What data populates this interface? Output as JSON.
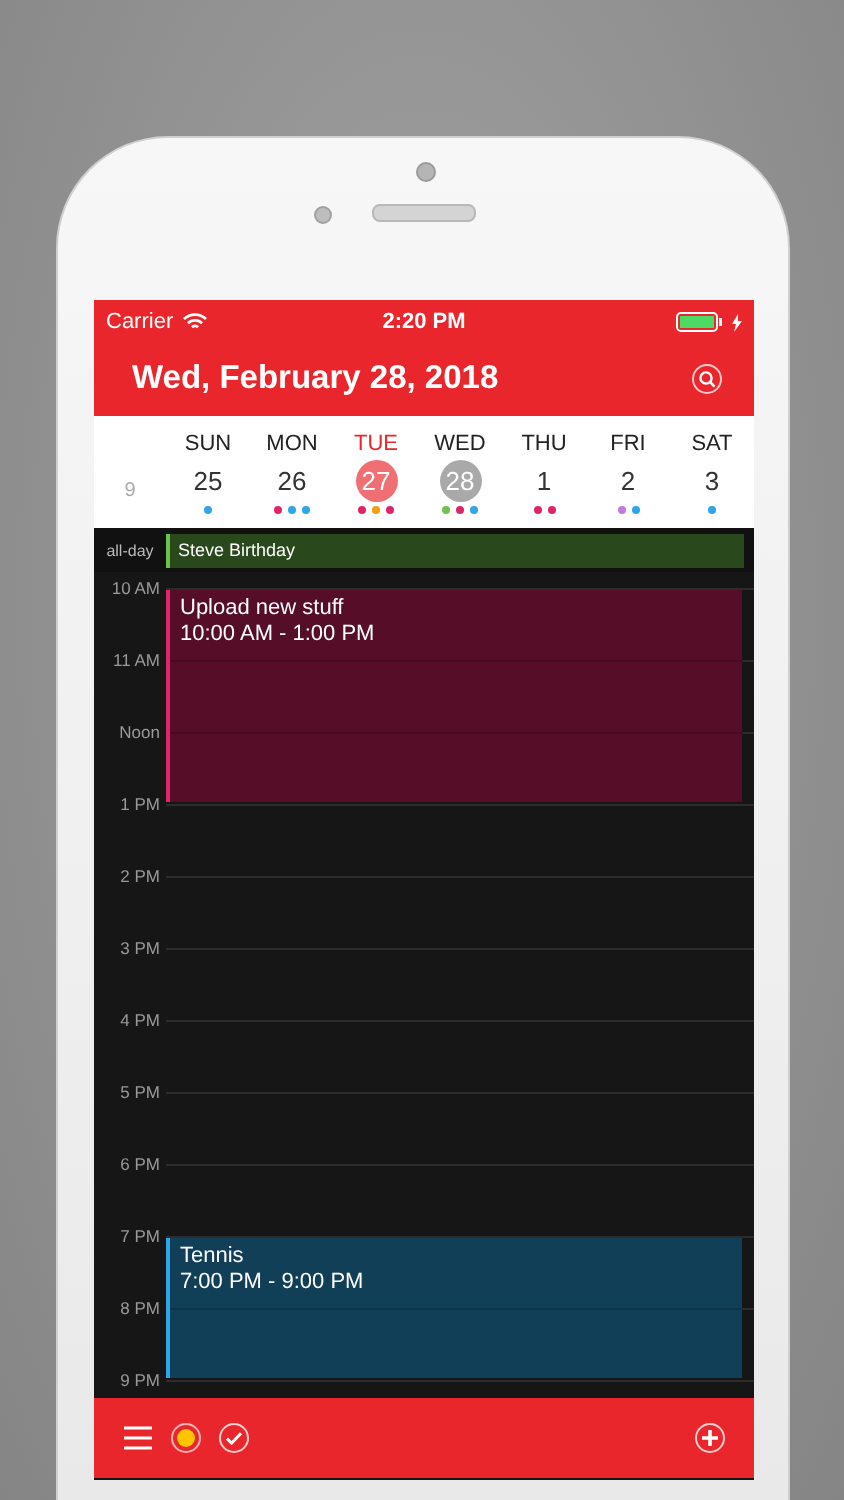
{
  "status_bar": {
    "carrier": "Carrier",
    "time": "2:20 PM",
    "charging": true
  },
  "header": {
    "title": "Wed, February 28, 2018"
  },
  "week": {
    "week_number": "9",
    "days": [
      {
        "weekday": "SUN",
        "date": "25",
        "today": false,
        "selected": false,
        "dots": [
          {
            "color": "#2ea7e8"
          }
        ]
      },
      {
        "weekday": "MON",
        "date": "26",
        "today": false,
        "selected": false,
        "dots": [
          {
            "color": "#e0246a"
          },
          {
            "color": "#2ea7e8"
          },
          {
            "color": "#2ea7e8"
          }
        ]
      },
      {
        "weekday": "TUE",
        "date": "27",
        "today": true,
        "selected": false,
        "dots": [
          {
            "color": "#e0246a"
          },
          {
            "color": "#f39c12"
          },
          {
            "color": "#e0246a"
          }
        ]
      },
      {
        "weekday": "WED",
        "date": "28",
        "today": false,
        "selected": true,
        "dots": [
          {
            "color": "#6cc24a"
          },
          {
            "color": "#e0246a"
          },
          {
            "color": "#2ea7e8"
          }
        ]
      },
      {
        "weekday": "THU",
        "date": "1",
        "today": false,
        "selected": false,
        "dots": [
          {
            "color": "#e0246a"
          },
          {
            "color": "#e0246a"
          }
        ]
      },
      {
        "weekday": "FRI",
        "date": "2",
        "today": false,
        "selected": false,
        "dots": [
          {
            "color": "#c07be0"
          },
          {
            "color": "#2ea7e8"
          }
        ]
      },
      {
        "weekday": "SAT",
        "date": "3",
        "today": false,
        "selected": false,
        "dots": [
          {
            "color": "#2ea7e8"
          }
        ]
      }
    ]
  },
  "all_day": {
    "label": "all-day",
    "events": [
      {
        "title": "Steve Birthday",
        "color": "#6cc24a"
      }
    ]
  },
  "hours": [
    {
      "label": "10 AM",
      "events": [
        {
          "title": "Upload new stuff",
          "time": "10:00 AM - 1:00 PM",
          "color": "#e0246a"
        }
      ]
    },
    {
      "label": "11 AM"
    },
    {
      "label": "Noon"
    },
    {
      "label": "1 PM"
    },
    {
      "label": "2 PM"
    },
    {
      "label": "3 PM"
    },
    {
      "label": "4 PM"
    },
    {
      "label": "5 PM"
    },
    {
      "label": "6 PM"
    },
    {
      "label": "7 PM",
      "events": [
        {
          "title": "Tennis",
          "time": "7:00 PM - 9:00 PM",
          "color": "#2ea7e8"
        }
      ]
    },
    {
      "label": "8 PM"
    },
    {
      "label": "9 PM"
    }
  ],
  "toolbar": [
    {
      "kind": "menu"
    },
    {
      "kind": "record"
    },
    {
      "kind": "check"
    },
    {
      "kind": "spacer"
    },
    {
      "kind": "add"
    }
  ]
}
